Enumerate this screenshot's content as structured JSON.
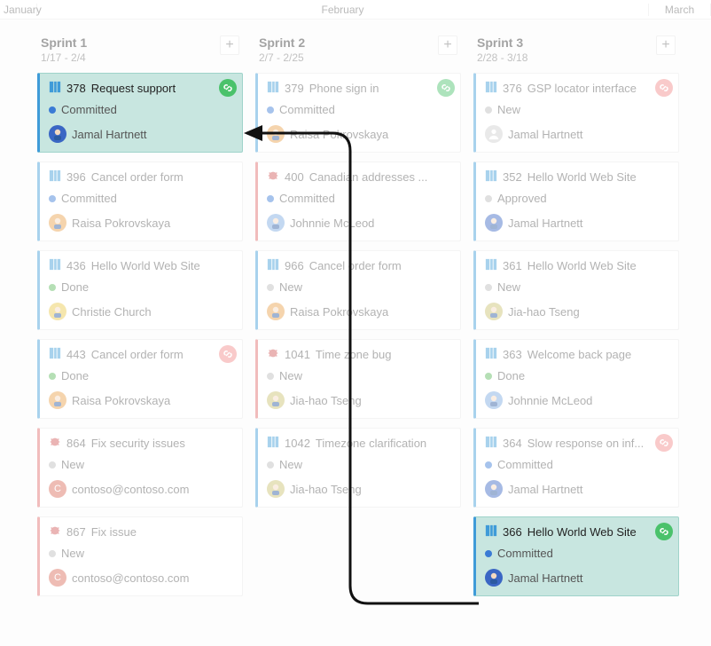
{
  "months": {
    "jan": "January",
    "feb": "February",
    "mar": "March"
  },
  "columns": [
    {
      "title": "Sprint 1",
      "range": "1/17 - 2/4",
      "cards": [
        {
          "kind": "story",
          "id": "378",
          "title": "Request support",
          "state": "Committed",
          "stateDot": "committed",
          "person": "Jamal Hartnett",
          "avatar": "jamal",
          "link": "green",
          "hi": true
        },
        {
          "kind": "story",
          "id": "396",
          "title": "Cancel order form",
          "state": "Committed",
          "stateDot": "committed",
          "person": "Raisa Pokrovskaya",
          "avatar": "raisa"
        },
        {
          "kind": "story",
          "id": "436",
          "title": "Hello World Web Site",
          "state": "Done",
          "stateDot": "done",
          "person": "Christie Church",
          "avatar": "christie"
        },
        {
          "kind": "story",
          "id": "443",
          "title": "Cancel order form",
          "state": "Done",
          "stateDot": "done",
          "person": "Raisa Pokrovskaya",
          "avatar": "raisa",
          "link": "red"
        },
        {
          "kind": "bug",
          "id": "864",
          "title": "Fix security issues",
          "state": "New",
          "stateDot": "new",
          "person": "contoso@contoso.com",
          "avatar": "contoso"
        },
        {
          "kind": "bug",
          "id": "867",
          "title": "Fix issue",
          "state": "New",
          "stateDot": "new",
          "person": "contoso@contoso.com",
          "avatar": "contoso"
        }
      ]
    },
    {
      "title": "Sprint 2",
      "range": "2/7 - 2/25",
      "cards": [
        {
          "kind": "story",
          "id": "379",
          "title": "Phone sign in",
          "state": "Committed",
          "stateDot": "committed",
          "person": "Raisa Pokrovskaya",
          "avatar": "raisa",
          "link": "green"
        },
        {
          "kind": "bug",
          "id": "400",
          "title": "Canadian addresses ...",
          "state": "Committed",
          "stateDot": "committed",
          "person": "Johnnie McLeod",
          "avatar": "johnnie"
        },
        {
          "kind": "story",
          "id": "966",
          "title": "Cancel order form",
          "state": "New",
          "stateDot": "new",
          "person": "Raisa Pokrovskaya",
          "avatar": "raisa"
        },
        {
          "kind": "bug",
          "id": "1041",
          "title": "Time zone bug",
          "state": "New",
          "stateDot": "new",
          "person": "Jia-hao Tseng",
          "avatar": "jiahao"
        },
        {
          "kind": "story",
          "id": "1042",
          "title": "Timezone clarification",
          "state": "New",
          "stateDot": "new",
          "person": "Jia-hao Tseng",
          "avatar": "jiahao"
        }
      ]
    },
    {
      "title": "Sprint 3",
      "range": "2/28 - 3/18",
      "cards": [
        {
          "kind": "story",
          "id": "376",
          "title": "GSP locator interface",
          "state": "New",
          "stateDot": "new",
          "person": "Jamal Hartnett",
          "avatar": "unassigned",
          "link": "red"
        },
        {
          "kind": "story",
          "id": "352",
          "title": "Hello World Web Site",
          "state": "Approved",
          "stateDot": "approved",
          "person": "Jamal Hartnett",
          "avatar": "jamal"
        },
        {
          "kind": "story",
          "id": "361",
          "title": "Hello World Web Site",
          "state": "New",
          "stateDot": "new",
          "person": "Jia-hao Tseng",
          "avatar": "jiahao"
        },
        {
          "kind": "story",
          "id": "363",
          "title": "Welcome back page",
          "state": "Done",
          "stateDot": "done",
          "person": "Johnnie McLeod",
          "avatar": "johnnie"
        },
        {
          "kind": "story",
          "id": "364",
          "title": "Slow response on inf...",
          "state": "Committed",
          "stateDot": "committed",
          "person": "Jamal Hartnett",
          "avatar": "jamal",
          "link": "red"
        },
        {
          "kind": "story",
          "id": "366",
          "title": "Hello World Web Site",
          "state": "Committed",
          "stateDot": "committed",
          "person": "Jamal Hartnett",
          "avatar": "jamal",
          "link": "green",
          "hi": true
        }
      ]
    }
  ]
}
